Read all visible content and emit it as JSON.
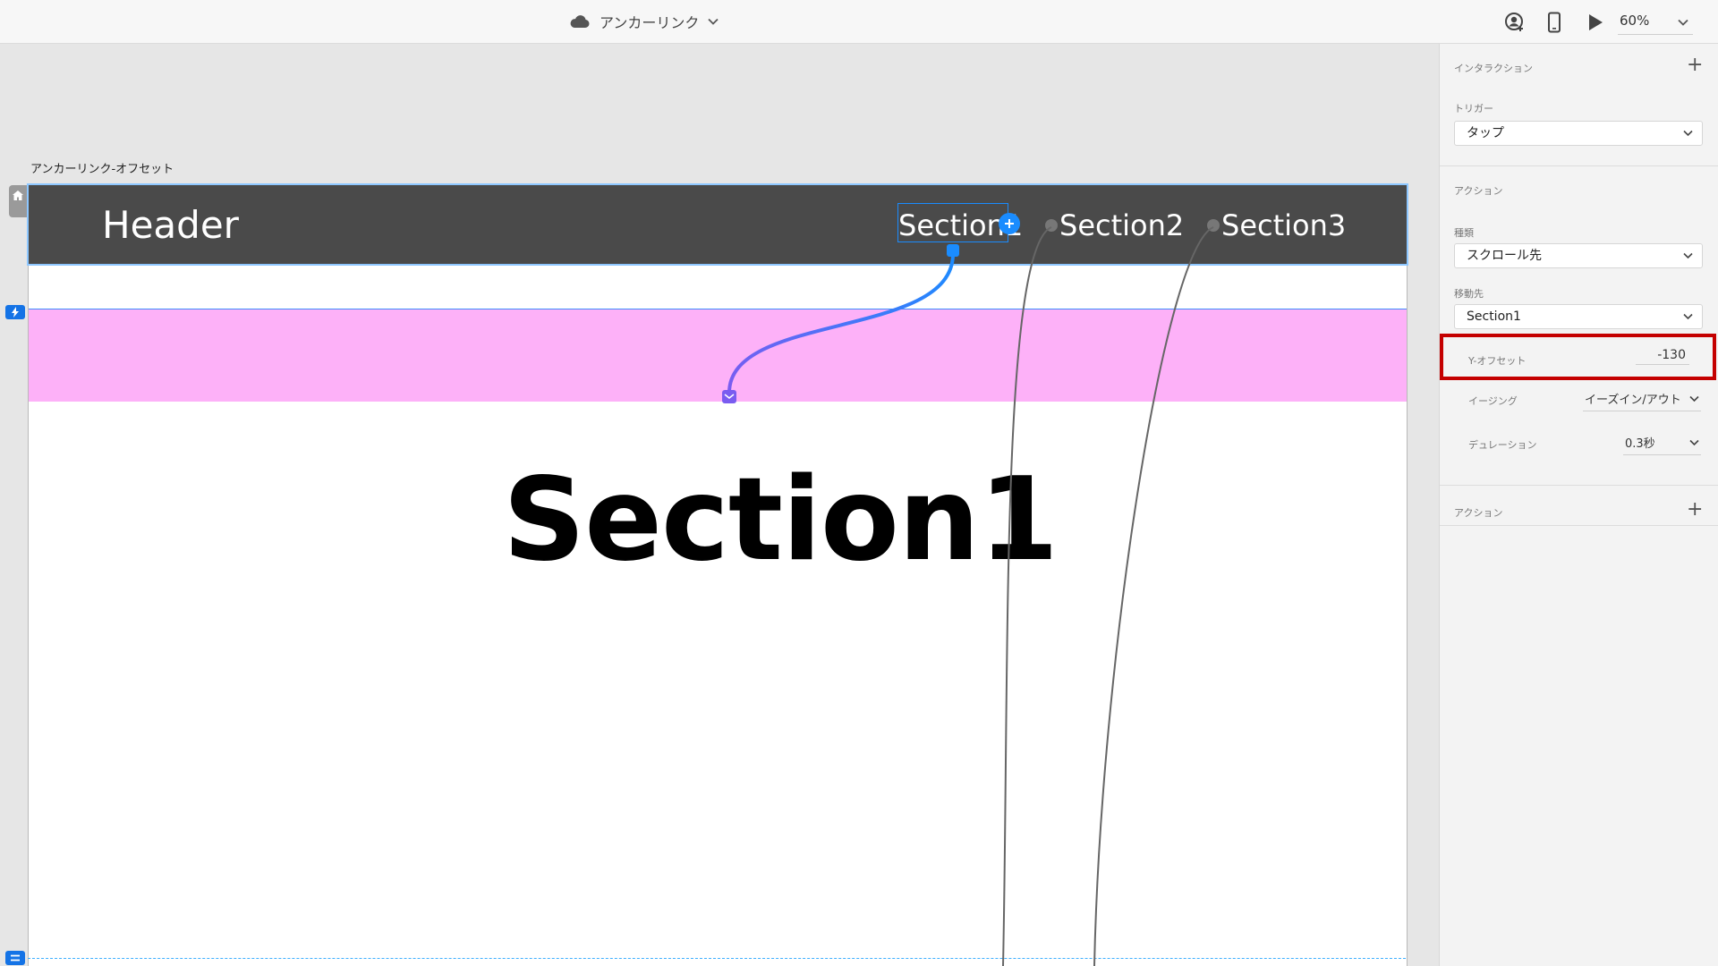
{
  "topbar": {
    "doc_title": "アンカーリンク",
    "zoom": "60%",
    "icons": [
      "user-share-icon",
      "mobile-device-icon",
      "play-icon",
      "chevron-down-icon"
    ]
  },
  "canvas": {
    "artboard_label": "アンカーリンク-オフセット",
    "header_title": "Header",
    "nav": [
      "Section1",
      "Section2",
      "Section3"
    ],
    "section_heading": "Section1",
    "colors": {
      "header_bg": "#4a4a4a",
      "band": "#fdb1f8",
      "accent": "#1a8cff"
    }
  },
  "panel": {
    "interaction_title": "インタラクション",
    "trigger_label": "トリガー",
    "trigger_value": "タップ",
    "action_title": "アクション",
    "type_label": "種類",
    "type_value": "スクロール先",
    "destination_label": "移動先",
    "destination_value": "Section1",
    "y_offset_label": "Y-オフセット",
    "y_offset_value": "-130",
    "easing_label": "イージング",
    "easing_value": "イーズイン/アウト",
    "duration_label": "デュレーション",
    "duration_value": "0.3秒",
    "add_action_label": "アクション",
    "highlight_color": "#c40000"
  }
}
